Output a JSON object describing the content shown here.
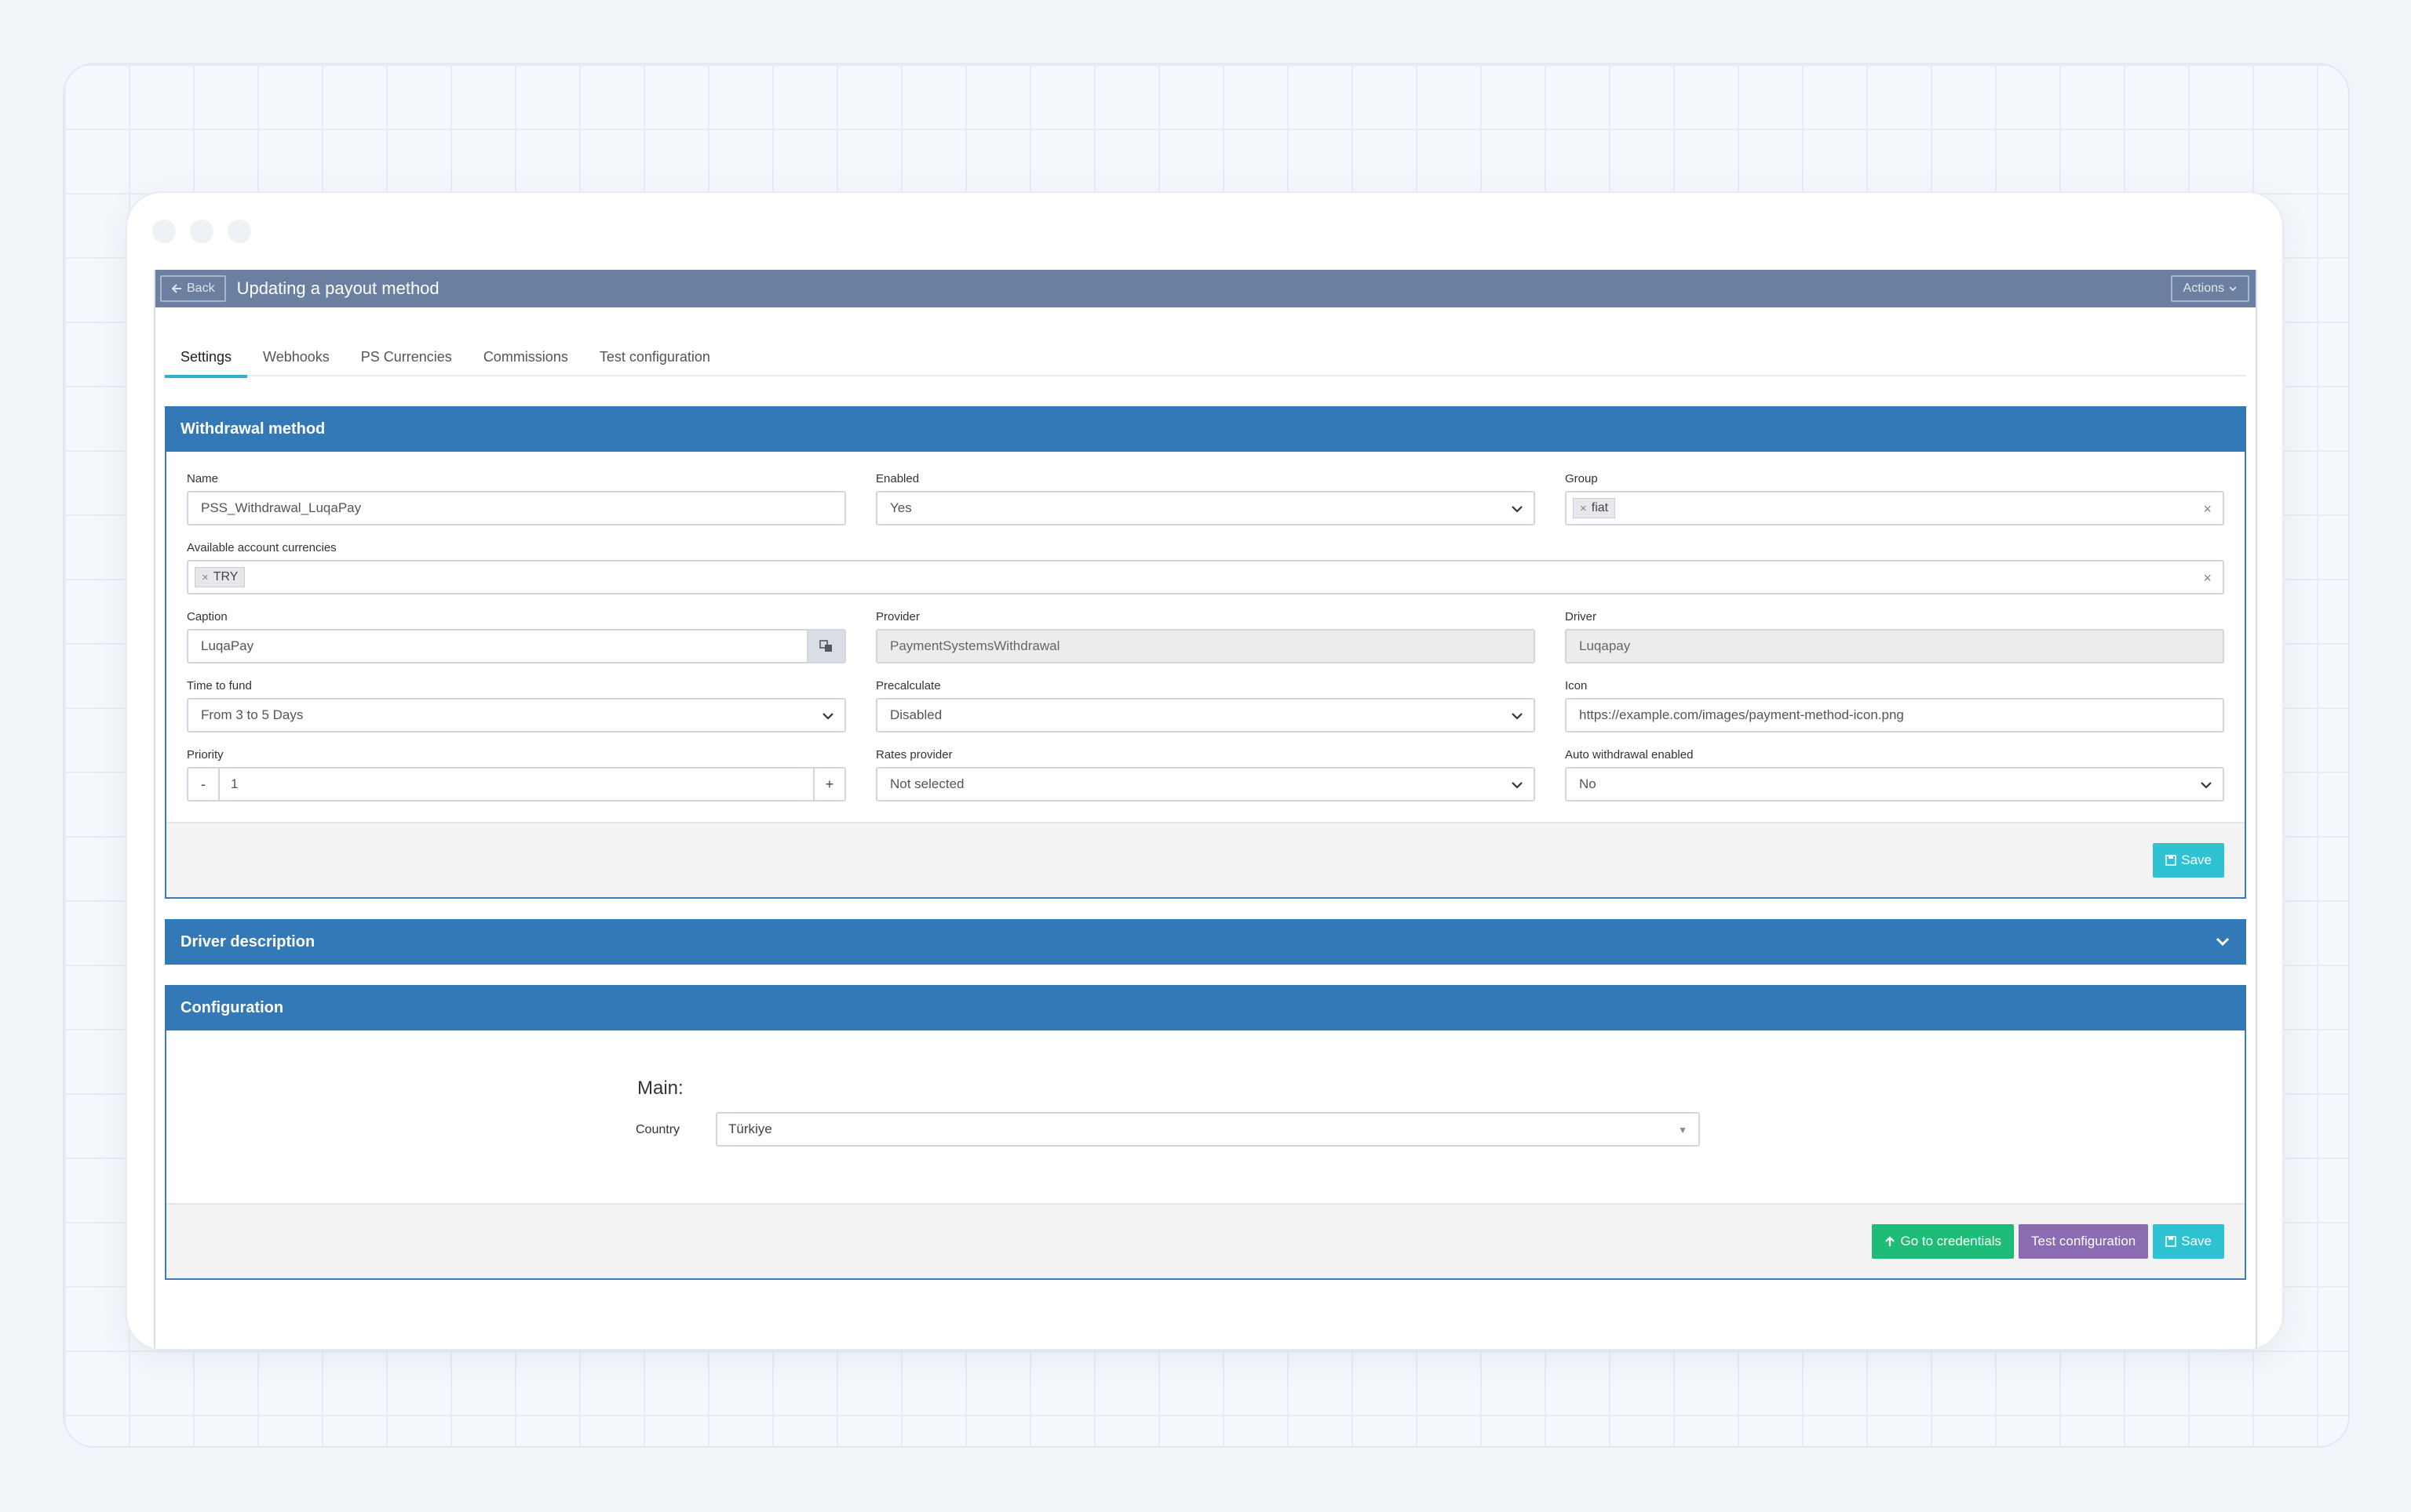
{
  "header": {
    "back_label": "Back",
    "title": "Updating a payout method",
    "actions_label": "Actions"
  },
  "tabs": [
    {
      "label": "Settings",
      "active": true
    },
    {
      "label": "Webhooks"
    },
    {
      "label": "PS Currencies"
    },
    {
      "label": "Commissions"
    },
    {
      "label": "Test configuration"
    }
  ],
  "withdrawal": {
    "title": "Withdrawal method",
    "name_label": "Name",
    "name_value": "PSS_Withdrawal_LuqaPay",
    "enabled_label": "Enabled",
    "enabled_value": "Yes",
    "group_label": "Group",
    "group_tag": "fiat",
    "currencies_label": "Available account currencies",
    "currency_tag": "TRY",
    "caption_label": "Caption",
    "caption_value": "LuqaPay",
    "provider_label": "Provider",
    "provider_value": "PaymentSystemsWithdrawal",
    "driver_label": "Driver",
    "driver_value": "Luqapay",
    "time_label": "Time to fund",
    "time_value": "From 3 to 5 Days",
    "precalc_label": "Precalculate",
    "precalc_value": "Disabled",
    "icon_label": "Icon",
    "icon_value": "https://example.com/images/payment-method-icon.png",
    "priority_label": "Priority",
    "priority_value": "1",
    "minus": "-",
    "plus": "+",
    "rates_label": "Rates provider",
    "rates_value": "Not selected",
    "auto_label": "Auto withdrawal enabled",
    "auto_value": "No",
    "save_label": "Save"
  },
  "driver_description": {
    "title": "Driver description"
  },
  "configuration": {
    "title": "Configuration",
    "main_label": "Main:",
    "country_label": "Country",
    "country_value": "Türkiye",
    "credentials_label": "Go to credentials",
    "test_label": "Test configuration",
    "save_label": "Save"
  },
  "colors": {
    "header_bg": "#6b7fa0",
    "panel_head": "#3379b8",
    "accent_cyan": "#2ec2d2",
    "accent_green": "#1fbb78",
    "accent_purple": "#8b6bb1"
  }
}
